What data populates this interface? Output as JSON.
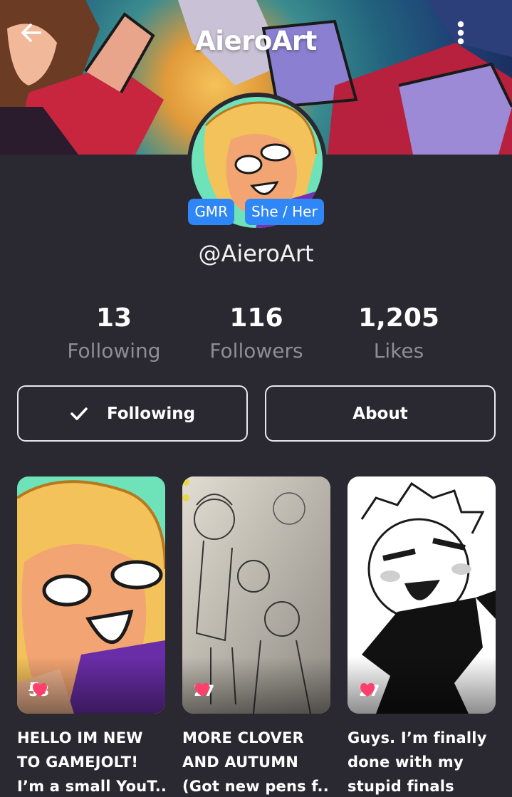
{
  "header": {
    "title": "AieroArt",
    "back_icon": "arrow-left-icon",
    "menu_icon": "more-vertical-icon"
  },
  "profile": {
    "tags": [
      "GMR",
      "She / Her"
    ],
    "username": "@AieroArt"
  },
  "stats": [
    {
      "value": "13",
      "label": "Following"
    },
    {
      "value": "116",
      "label": "Followers"
    },
    {
      "value": "1,205",
      "label": "Likes"
    }
  ],
  "actions": {
    "following_label": "Following",
    "about_label": "About"
  },
  "posts": [
    {
      "likes": "53",
      "pinned": true,
      "caption": [
        "HELLO IM NEW",
        "TO GAMEJOLT!",
        "I’m a small YouT..."
      ]
    },
    {
      "likes": "27",
      "pinned": false,
      "caption": [
        "MORE CLOVER",
        "AND AUTUMN",
        "(Got new pens f..."
      ]
    },
    {
      "likes": "27",
      "pinned": false,
      "caption": [
        "Guys. I’m finally",
        "done with my",
        "stupid finals"
      ]
    }
  ],
  "colors": {
    "background": "#2a2830",
    "tag": "#2f86f6",
    "heart": "#ff3f6c",
    "muted_text": "#8e8c94"
  }
}
